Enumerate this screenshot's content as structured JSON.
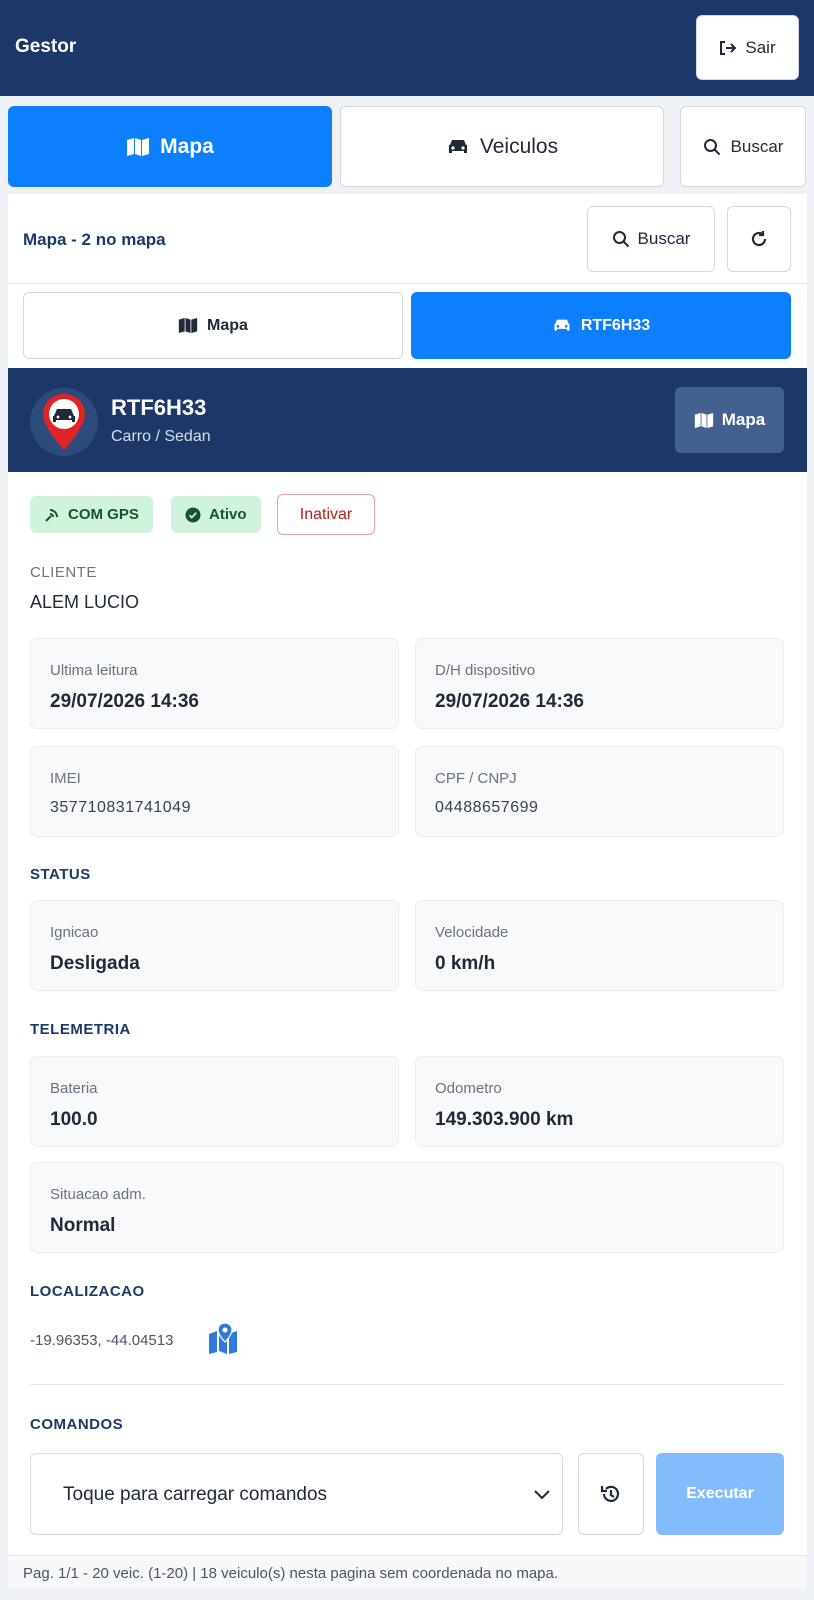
{
  "app": {
    "title": "Gestor",
    "logout_label": "Sair"
  },
  "main_tabs": [
    {
      "label": "Mapa",
      "icon": "map-icon",
      "active": true
    },
    {
      "label": "Veiculos",
      "icon": "car-icon",
      "active": false
    },
    {
      "label": "Buscar",
      "icon": "search-icon",
      "active": false
    }
  ],
  "panel": {
    "title": "Mapa - 2 no mapa",
    "search_label": "Buscar",
    "refresh_icon": "refresh-icon"
  },
  "sub_tabs": [
    {
      "label": "Mapa",
      "icon": "map-icon",
      "active": false
    },
    {
      "label": "RTF6H33",
      "icon": "car-icon",
      "active": true
    }
  ],
  "vehicle": {
    "plate": "RTF6H33",
    "type": "Carro / Sedan",
    "map_button_label": "Mapa",
    "badges": {
      "gps": "COM GPS",
      "active": "Ativo"
    },
    "deactivate_label": "Inativar",
    "client_label": "CLIENTE",
    "client_name": "ALEM LUCIO",
    "info": {
      "last_reading_label": "Ultima leitura",
      "last_reading": "29/07/2026 14:36",
      "device_dt_label": "D/H dispositivo",
      "device_dt": "29/07/2026 14:36",
      "imei_label": "IMEI",
      "imei": "357710831741049",
      "doc_label": "CPF / CNPJ",
      "doc": "04488657699"
    },
    "status": {
      "title": "STATUS",
      "ignition_label": "Ignicao",
      "ignition": "Desligada",
      "speed_label": "Velocidade",
      "speed": "0 km/h"
    },
    "telemetry": {
      "title": "TELEMETRIA",
      "battery_label": "Bateria",
      "battery": "100.0",
      "odometer_label": "Odometro",
      "odometer": "149.303.900 km",
      "admin_label": "Situacao adm.",
      "admin": "Normal"
    },
    "location": {
      "title": "LOCALIZACAO",
      "coords": "-19.96353, -44.04513"
    },
    "commands": {
      "title": "COMANDOS",
      "select_text": "Toque para carregar comandos",
      "execute_label": "Executar"
    }
  },
  "footer": {
    "text": "Pag. 1/1 - 20 veic. (1-20) | 18 veiculo(s) nesta pagina sem coordenada no mapa."
  },
  "colors": {
    "navy": "#1d3868",
    "primary": "#0d7efc",
    "success_bg": "#d1f2dc",
    "danger": "#b42318"
  }
}
